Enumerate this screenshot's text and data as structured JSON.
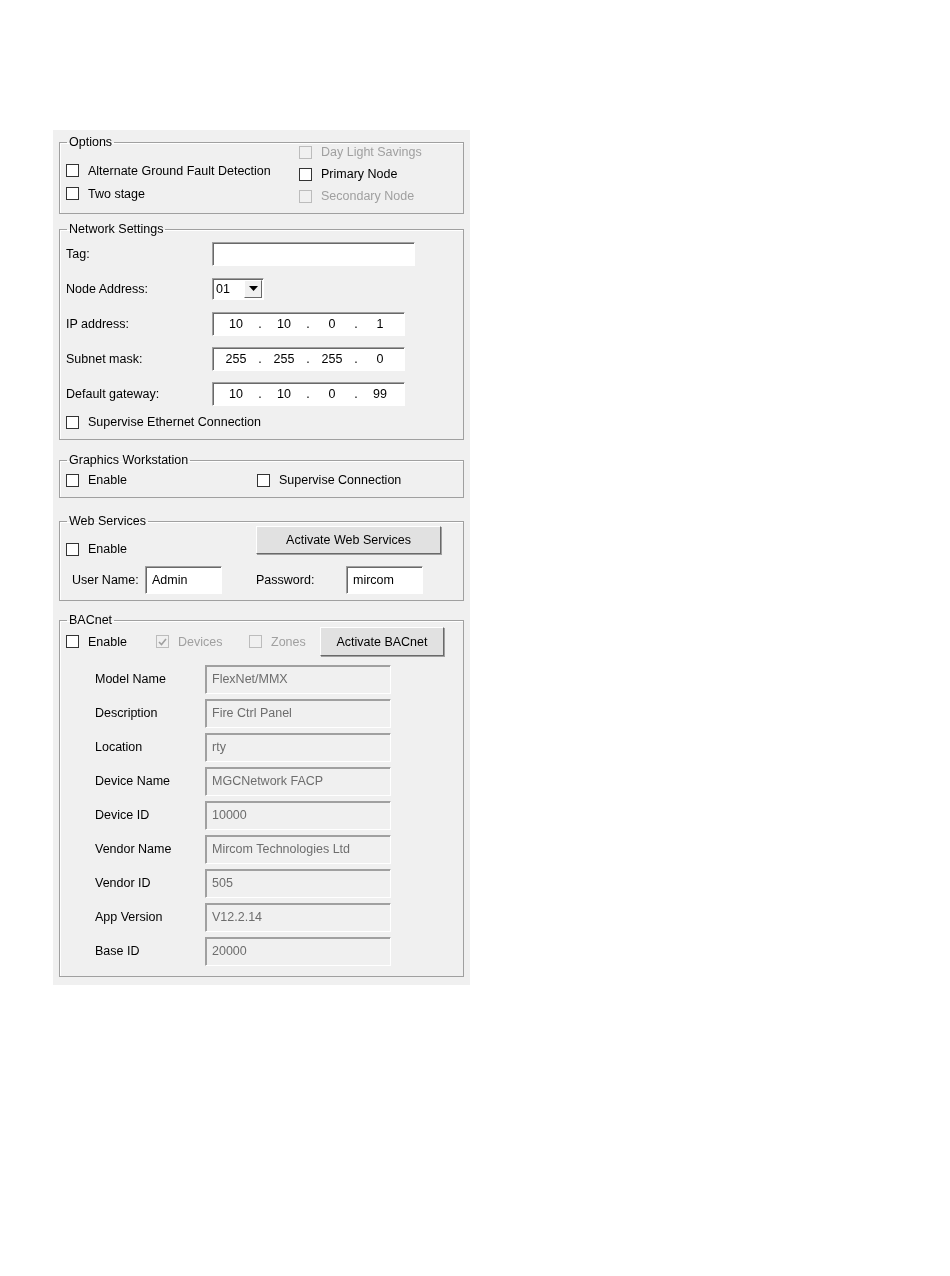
{
  "options": {
    "title": "Options",
    "left": [
      {
        "label": "Alternate Ground Fault Detection",
        "checked": false,
        "disabled": false
      },
      {
        "label": "Two stage",
        "checked": false,
        "disabled": false
      }
    ],
    "right": [
      {
        "label": "Day Light Savings",
        "checked": false,
        "disabled": true
      },
      {
        "label": "Primary Node",
        "checked": false,
        "disabled": false
      },
      {
        "label": "Secondary Node",
        "checked": false,
        "disabled": true
      }
    ]
  },
  "network_settings": {
    "title": "Network Settings",
    "fields": [
      {
        "kind": "text",
        "label": "Tag:"
      },
      {
        "kind": "combo",
        "label": "Node Address:",
        "value": "01"
      },
      {
        "kind": "ip",
        "label": "IP address:",
        "parts": [
          "10",
          ".",
          "10",
          ".",
          "0",
          ".",
          "1"
        ]
      },
      {
        "kind": "ip",
        "label": "Subnet mask:",
        "parts": [
          "255",
          ".",
          "255",
          ".",
          "255",
          ".",
          "0"
        ]
      },
      {
        "kind": "ip",
        "label": "Default gateway:",
        "parts": [
          "10",
          ".",
          "10",
          ".",
          "0",
          ".",
          "99"
        ]
      }
    ],
    "supervise": {
      "label": "Supervise Ethernet Connection",
      "checked": false,
      "disabled": false
    }
  },
  "graphics_workstation": {
    "title": "Graphics Workstation",
    "checkboxes": [
      {
        "label": "Enable",
        "checked": false,
        "disabled": false
      },
      {
        "label": "Supervise Connection",
        "checked": false,
        "disabled": false
      }
    ]
  },
  "web_services": {
    "title": "Web Services",
    "enable": {
      "label": "Enable",
      "checked": false,
      "disabled": false
    },
    "button": "Activate Web Services",
    "user_name": {
      "label": "User Name:",
      "value": "Admin"
    },
    "password": {
      "label": "Password:",
      "value": "mircom"
    }
  },
  "bacnet": {
    "title": "BACnet",
    "checkboxes": [
      {
        "label": "Enable",
        "checked": false,
        "disabled": false
      },
      {
        "label": "Devices",
        "checked": true,
        "disabled": true
      },
      {
        "label": "Zones",
        "checked": false,
        "disabled": true
      }
    ],
    "button": "Activate BACnet",
    "fields": [
      {
        "label": "Model Name",
        "value": "FlexNet/MMX",
        "disabled": true
      },
      {
        "label": "Description",
        "value": "Fire Ctrl Panel",
        "disabled": true
      },
      {
        "label": "Location",
        "value": "rty",
        "disabled": true
      },
      {
        "label": "Device Name",
        "value": "MGCNetwork FACP",
        "disabled": true
      },
      {
        "label": "Device ID",
        "value": "10000",
        "disabled": true
      },
      {
        "label": "Vendor Name",
        "value": "Mircom Technologies Ltd",
        "disabled": true
      },
      {
        "label": "Vendor ID",
        "value": "505",
        "disabled": true
      },
      {
        "label": "App Version",
        "value": "V12.2.14",
        "disabled": true
      },
      {
        "label": "Base ID",
        "value": "20000",
        "disabled": true
      }
    ]
  }
}
